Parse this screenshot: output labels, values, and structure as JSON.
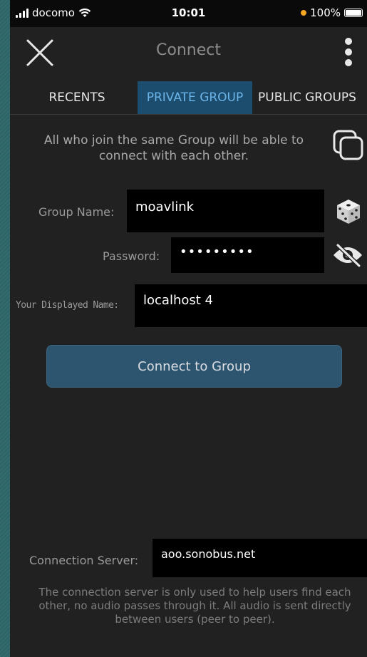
{
  "status_bar": {
    "carrier": "docomo",
    "time": "10:01",
    "battery": "100%"
  },
  "header": {
    "title": "Connect"
  },
  "tabs": [
    {
      "label": "RECENTS",
      "active": false
    },
    {
      "label": "PRIVATE GROUP",
      "active": true
    },
    {
      "label": "PUBLIC GROUPS",
      "active": false
    }
  ],
  "info": {
    "text": "All who join the same Group will be able to connect with each other."
  },
  "form": {
    "group_name_label": "Group Name:",
    "group_name_value": "moavlink",
    "password_label": "Password:",
    "password_value": "•••••••••",
    "display_name_label": "Your Displayed Name:",
    "display_name_value": "localhost 4"
  },
  "connect_button": {
    "label": "Connect to Group"
  },
  "server": {
    "label": "Connection Server:",
    "value": "aoo.sonobus.net",
    "note": "The connection server is only used to help users find each other, no audio passes through it. All audio is sent directly between users (peer to peer)."
  },
  "icons": {
    "close": "close-icon",
    "menu": "more-vertical-icon",
    "copy": "copy-icon",
    "dice": "dice-icon",
    "visibility": "eye-off-icon"
  },
  "colors": {
    "active_tab_bg": "#1d4d6e",
    "active_tab_text": "#6bb4e8",
    "button_bg": "#2e5570",
    "background": "#212121"
  }
}
